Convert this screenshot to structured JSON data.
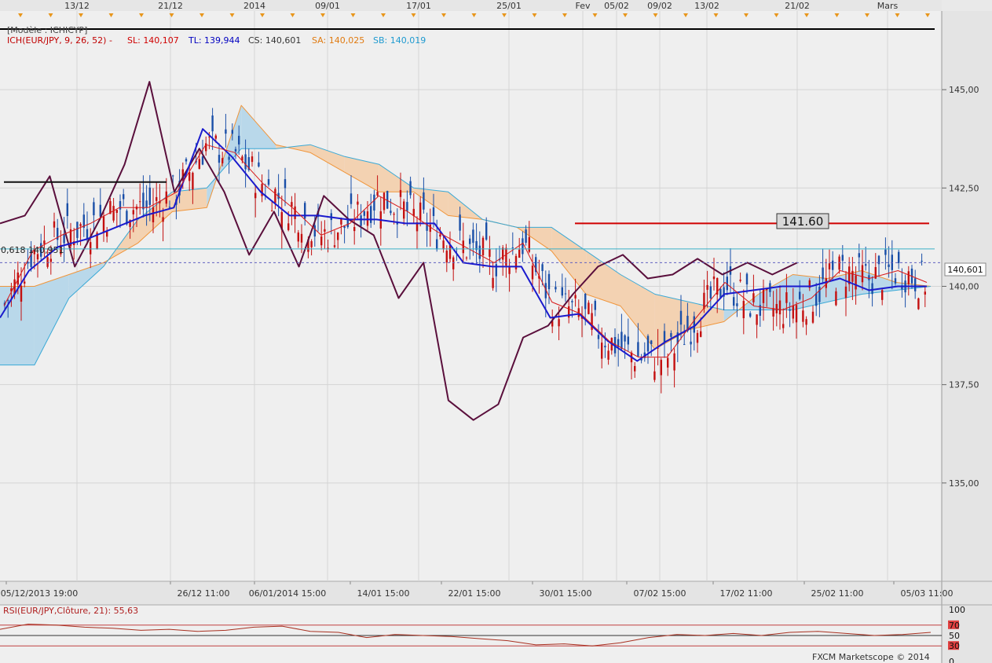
{
  "chart_data": [
    {
      "type": "candlestick",
      "title": "[Modèle : ICHICYP]",
      "indicator_legend": {
        "name": "ICH(EUR/JPY, 9, 26, 52) -",
        "sl": "SL: 140,107",
        "tl": "TL: 139,944",
        "cs": "CS: 140,601",
        "sa": "SA: 140,025",
        "sb": "SB: 140,019"
      },
      "top_dates": [
        "13/12",
        "21/12",
        "2014",
        "09/01",
        "17/01",
        "25/01",
        "Fev",
        "05/02",
        "09/02",
        "13/02",
        "21/02",
        "Mars"
      ],
      "bottom_dates": [
        "05/12/2013 19:00",
        "26/12 11:00",
        "06/01/2014 15:00",
        "14/01 15:00",
        "22/01 15:00",
        "30/01 15:00",
        "07/02 15:00",
        "17/02 11:00",
        "25/02 11:00",
        "05/03 11:00"
      ],
      "y_ticks": [
        "145,00",
        "142,50",
        "140,00",
        "137,50",
        "135,00"
      ],
      "ylim": [
        132.5,
        147.0
      ],
      "last_price": 140.601,
      "last_price_label": "140,601",
      "price_line_label": "141.60",
      "price_line_value": 141.6,
      "left_text": "0,618 140,951",
      "series": [
        {
          "name": "ICH SL",
          "values": [
            139.5,
            140.9,
            141.3,
            141.6,
            142.0,
            142.0,
            142.4,
            143.6,
            143.4,
            142.6,
            142.0,
            141.3,
            141.6,
            142.3,
            141.9,
            141.4,
            141.0,
            140.6,
            141.1,
            139.6,
            139.3,
            138.6,
            138.2,
            138.2,
            139.2,
            140.1,
            139.5,
            139.4,
            139.7,
            140.4,
            140.2,
            140.4,
            140.1
          ]
        },
        {
          "name": "ICH TL",
          "values": [
            139.2,
            140.4,
            141.0,
            141.2,
            141.5,
            141.8,
            142.0,
            144.0,
            143.3,
            142.4,
            141.8,
            141.8,
            141.7,
            141.7,
            141.6,
            141.6,
            140.6,
            140.5,
            140.5,
            139.2,
            139.3,
            138.6,
            138.1,
            138.6,
            139.0,
            139.8,
            139.9,
            140.0,
            140.0,
            140.2,
            139.9,
            140.0,
            140.0
          ]
        },
        {
          "name": "ICH CS",
          "values": [
            141.6,
            141.8,
            142.8,
            140.5,
            141.7,
            143.1,
            145.2,
            142.4,
            143.5,
            142.4,
            140.8,
            141.9,
            140.5,
            142.3,
            141.7,
            141.3,
            139.7,
            140.6,
            137.1,
            136.6,
            137.0,
            138.7,
            139.0,
            139.8,
            140.5,
            140.8,
            140.2,
            140.3,
            140.7,
            140.3,
            140.6,
            140.3,
            140.6
          ]
        },
        {
          "name": "ICH SA",
          "values": [
            140.0,
            140.0,
            140.3,
            140.6,
            141.1,
            141.9,
            142.0,
            144.6,
            143.6,
            143.4,
            142.9,
            142.4,
            142.4,
            141.8,
            141.7,
            141.5,
            140.9,
            139.8,
            139.5,
            138.4,
            138.9,
            139.1,
            139.8,
            140.3,
            140.2,
            140.4,
            140.1,
            140.0
          ]
        },
        {
          "name": "ICH SB",
          "values": [
            138.0,
            138.0,
            139.7,
            140.5,
            141.7,
            142.4,
            142.5,
            143.5,
            143.5,
            143.6,
            143.3,
            143.1,
            142.5,
            142.4,
            141.7,
            141.5,
            141.5,
            140.9,
            140.3,
            139.8,
            139.6,
            139.4,
            139.4,
            139.4,
            139.6,
            139.8,
            139.9,
            140.0
          ]
        }
      ]
    },
    {
      "type": "line",
      "title": "RSI(EUR/JPY,Clôture, 21): 55,63",
      "y_ticks": [
        "100",
        "70",
        "50",
        "30",
        "0"
      ],
      "ylim": [
        0,
        100
      ],
      "series": [
        {
          "name": "RSI",
          "values": [
            62,
            72,
            70,
            66,
            64,
            60,
            62,
            58,
            60,
            66,
            68,
            58,
            56,
            46,
            52,
            50,
            48,
            44,
            40,
            32,
            34,
            30,
            36,
            46,
            52,
            50,
            54,
            50,
            56,
            58,
            54,
            50,
            52,
            56
          ]
        }
      ]
    }
  ],
  "footer": "FXCM Marketscope © 2014"
}
